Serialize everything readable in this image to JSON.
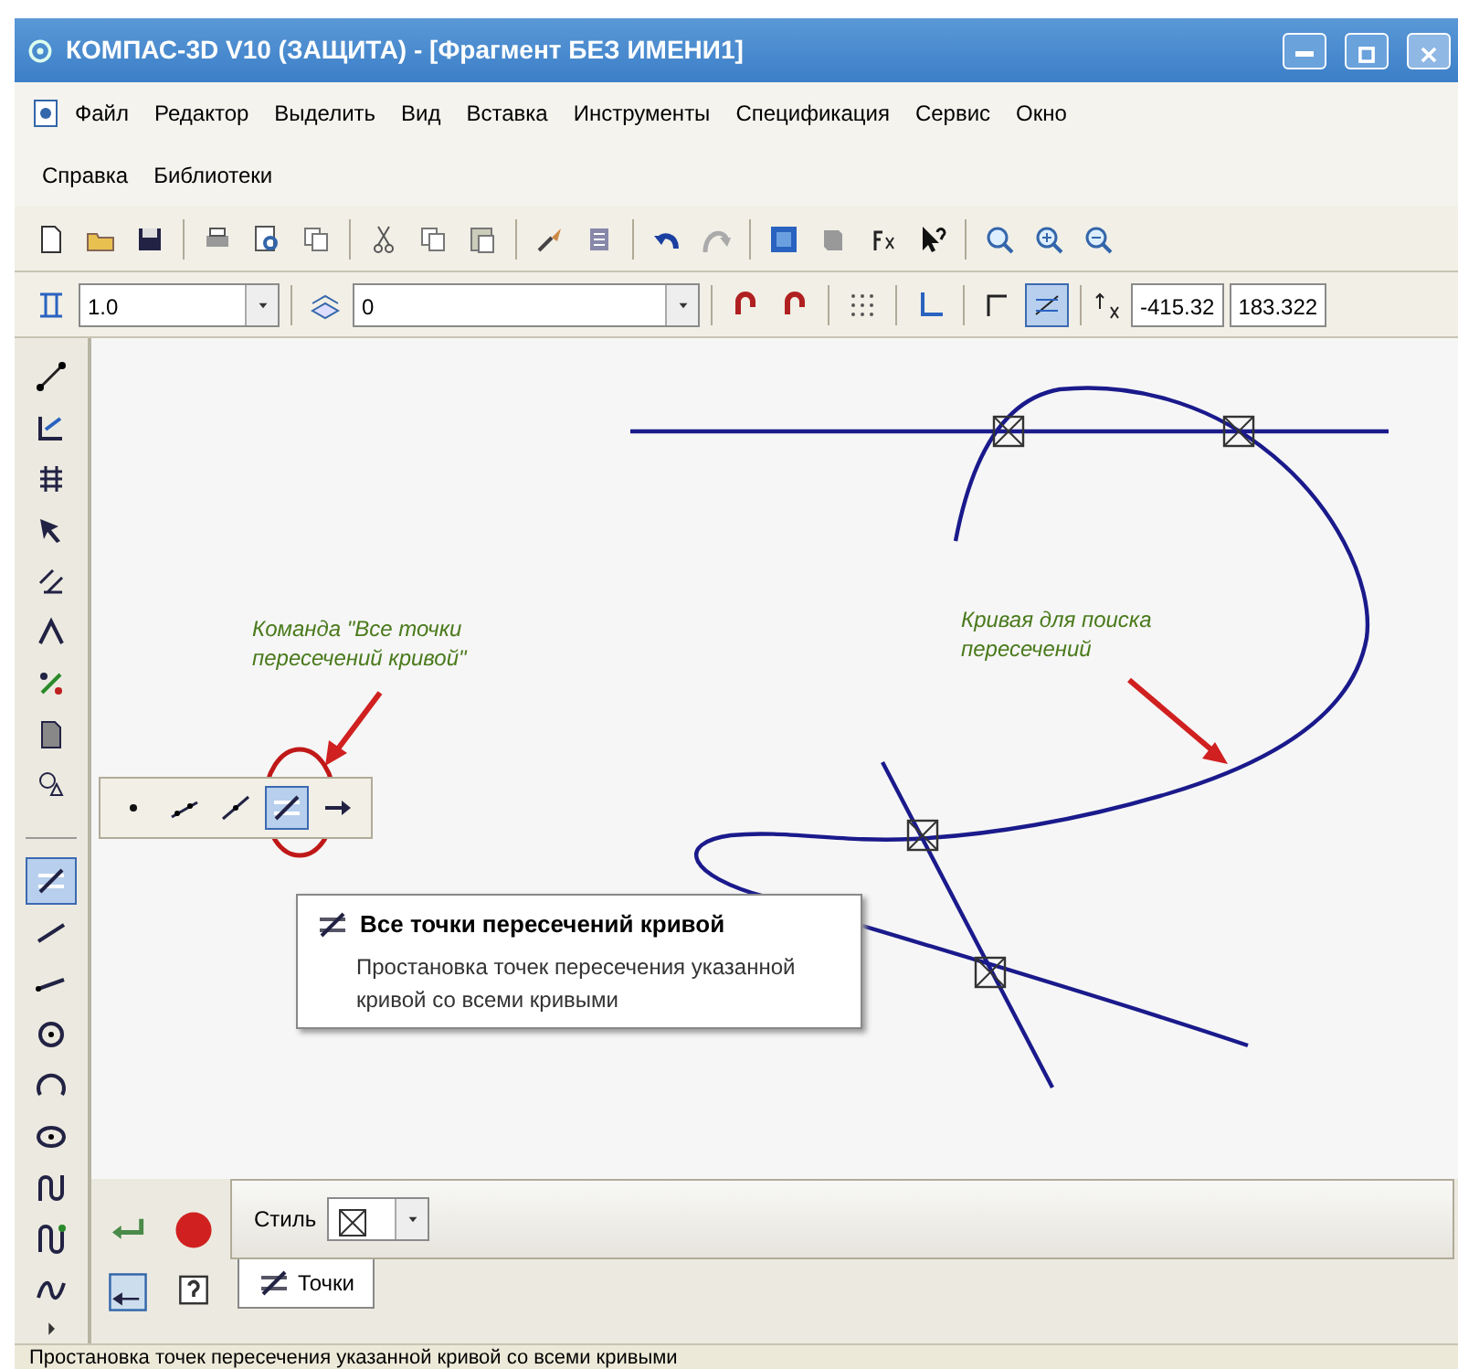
{
  "window": {
    "title": "КОМПАС-3D V10 (ЗАЩИТА) - [Фрагмент БЕЗ ИМЕНИ1]"
  },
  "menu_rows": [
    [
      "Файл",
      "Редактор",
      "Выделить",
      "Вид",
      "Вставка",
      "Инструменты",
      "Спецификация",
      "Сервис",
      "Окно"
    ],
    [
      "Справка",
      "Библиотеки"
    ]
  ],
  "current_state_bar": {
    "step": "1.0",
    "layer": "0",
    "coordinate_1": "-415.32",
    "coordinate_2": "183.322"
  },
  "left_toolbar": [
    {
      "selected": false
    },
    {
      "selected": false
    },
    {
      "selected": false
    },
    {
      "selected": false
    },
    {
      "selected": false
    },
    {
      "selected": false
    },
    {
      "selected": false
    },
    {
      "selected": false
    },
    {
      "selected": false
    },
    {
      "selected": true
    },
    {
      "selected": false
    },
    {
      "selected": false
    },
    {
      "selected": false
    },
    {
      "selected": false
    },
    {
      "selected": false
    },
    {
      "selected": false
    },
    {
      "selected": false
    },
    {
      "selected": false
    }
  ],
  "flyout": [
    {
      "kind": "point",
      "selected": false
    },
    {
      "kind": "points-on-curve",
      "selected": false
    },
    {
      "kind": "point-on-line",
      "selected": false
    },
    {
      "kind": "intersections",
      "selected": true
    },
    {
      "kind": "arrow",
      "selected": false
    }
  ],
  "annotations": [
    {
      "kind": "command",
      "text": "Команда \"Все точки пересечений кривой\""
    },
    {
      "kind": "curve",
      "text": "Кривая  для поиска пересечений"
    }
  ],
  "tooltip": {
    "title": "Все точки пересечений кривой",
    "description": "Простановка точек пересечения указанной кривой со всеми кривыми"
  },
  "properties": {
    "style_label": "Стиль",
    "tab": "Точки"
  },
  "status_bar": "Простановка точек пересечения указанной кривой со всеми кривыми"
}
